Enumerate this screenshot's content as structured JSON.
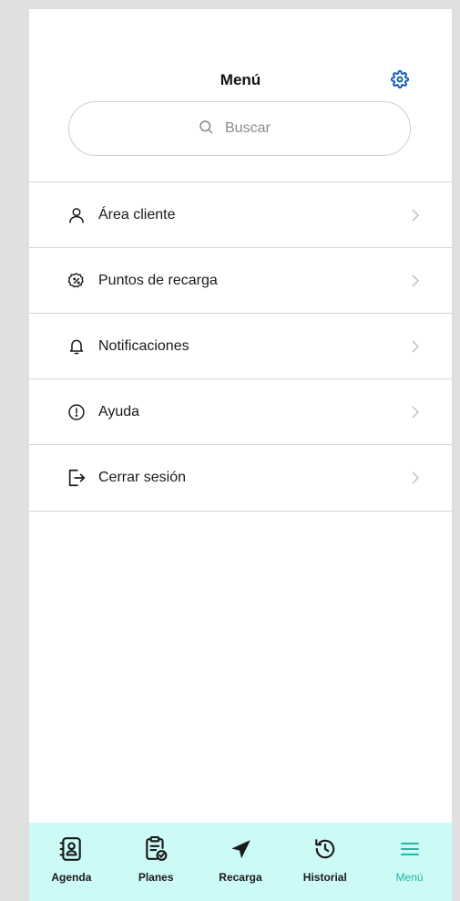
{
  "header": {
    "title": "Menú",
    "settings_icon": "gear-icon"
  },
  "search": {
    "placeholder": "Buscar",
    "value": "",
    "icon": "search-icon"
  },
  "menu": {
    "items": [
      {
        "label": "Área cliente",
        "icon": "user-icon"
      },
      {
        "label": "Puntos de recarga",
        "icon": "percent-badge-icon"
      },
      {
        "label": "Notificaciones",
        "icon": "bell-icon"
      },
      {
        "label": "Ayuda",
        "icon": "alert-circle-icon"
      },
      {
        "label": "Cerrar sesión",
        "icon": "logout-icon"
      }
    ]
  },
  "tabbar": {
    "active": "Menú",
    "tabs": [
      {
        "label": "Agenda",
        "icon": "contacts-icon"
      },
      {
        "label": "Planes",
        "icon": "clipboard-check-icon"
      },
      {
        "label": "Recarga",
        "icon": "navigation-arrow-icon"
      },
      {
        "label": "Historial",
        "icon": "history-icon"
      },
      {
        "label": "Menú",
        "icon": "hamburger-menu-icon"
      }
    ]
  },
  "colors": {
    "accent": "#1a5fb4",
    "tabbar_background": "#ccfaf7",
    "active_tab": "#26b5a8"
  }
}
